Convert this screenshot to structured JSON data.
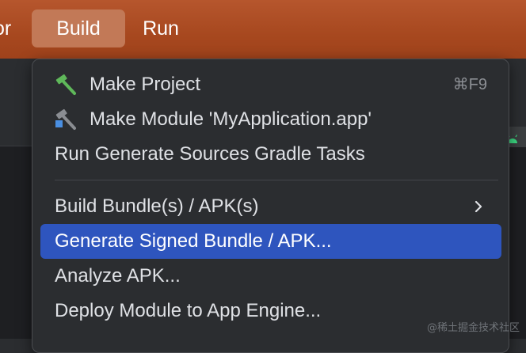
{
  "menubar": {
    "items": [
      {
        "label": "or"
      },
      {
        "label": "Build"
      },
      {
        "label": "Run"
      }
    ]
  },
  "build_menu": {
    "items": [
      {
        "label": "Make Project",
        "icon": "hammer-icon",
        "shortcut": "⌘F9"
      },
      {
        "label": "Make Module 'MyApplication.app'",
        "icon": "hammer-module-icon"
      },
      {
        "label": "Run Generate Sources Gradle Tasks"
      },
      {
        "label": "Build Bundle(s) / APK(s)",
        "submenu": true
      },
      {
        "label": "Generate Signed Bundle / APK...",
        "selected": true
      },
      {
        "label": "Analyze APK..."
      },
      {
        "label": "Deploy Module to App Engine..."
      }
    ]
  },
  "watermark": "@稀土掘金技术社区",
  "colors": {
    "menubar": "#a7481f",
    "active_menubar_item": "#c27957",
    "selection": "#2e55be",
    "menu_background": "#2b2d30",
    "menu_text": "#dfe1e5",
    "hammer_green": "#5fb85a"
  }
}
